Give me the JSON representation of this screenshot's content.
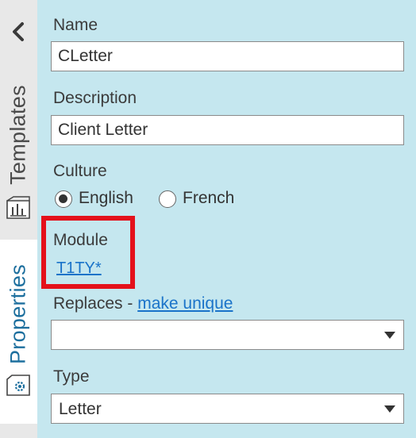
{
  "sidebar": {
    "collapse_icon": "chevron-left-icon",
    "tabs": [
      {
        "label": "Templates",
        "icon": "chart-icon",
        "active": false
      },
      {
        "label": "Properties",
        "icon": "gear-icon",
        "active": true
      }
    ]
  },
  "form": {
    "name": {
      "label": "Name",
      "value": "CLetter"
    },
    "description": {
      "label": "Description",
      "value": "Client Letter"
    },
    "culture": {
      "label": "Culture",
      "options": [
        "English",
        "French"
      ],
      "selected": "English"
    },
    "module": {
      "label": "Module",
      "value": "T1TY*"
    },
    "replaces": {
      "label": "Replaces - ",
      "link": "make unique",
      "value": ""
    },
    "type": {
      "label": "Type",
      "value": "Letter"
    }
  },
  "colors": {
    "panel_background": "#c5e7ef",
    "highlight": "#e4111b",
    "link": "#1a73c9",
    "active_tab_text": "#1d6f9e"
  }
}
